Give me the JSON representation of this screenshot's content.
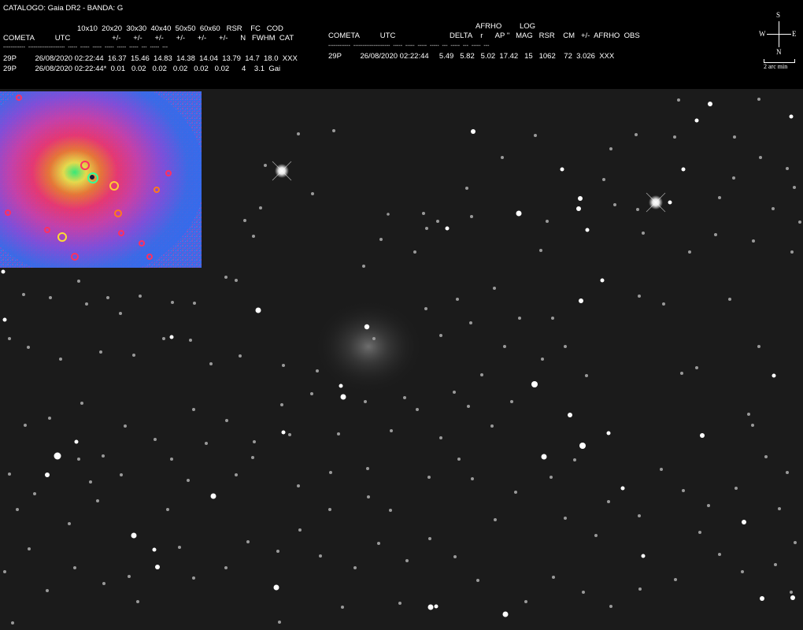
{
  "header": {
    "catalog_line": "CATALOGO: Gaia DR2 - BANDA: G",
    "left_table": {
      "row_top": "10x10  20x20  30x30  40x40  50x50  60x60   RSR    FC   COD",
      "row_headers": "COMETA          UTC                    +/-      +/-      +/-      +/-      +/-      +/-      N   FWHM  CAT",
      "row_dashes": "------------  --------------------  -----  -----  -----  -----  -----  -----  ---  -----  ---",
      "row_1": "29P         26/08/2020 02:22:44  16.37  15.46  14.83  14.38  14.04  13.79  14.7  18.0  XXX",
      "row_2": "29P         26/08/2020 02:22:44*  0.01   0.02   0.02   0.02   0.02   0.02      4    3.1  Gai"
    },
    "right_table": {
      "row_top1": "AFRHO",
      "row_top2": "LOG",
      "row_headers": "COMETA          UTC                          DELTA    r      AP \"   MAG   RSR    CM   +/-  AFRHO  OBS",
      "row_dashes": "------------  --------------------  -----  -----  -----  -----  ---  -----  ---  -----  ---",
      "row_1": "29P         26/08/2020 02:22:44     5.49   5.82   5.02  17.42   15   1062    72  3.026  XXX"
    },
    "compass": {
      "north": "N",
      "south": "S",
      "east": "E",
      "west": "W",
      "scale_label": "2 arc min"
    }
  }
}
